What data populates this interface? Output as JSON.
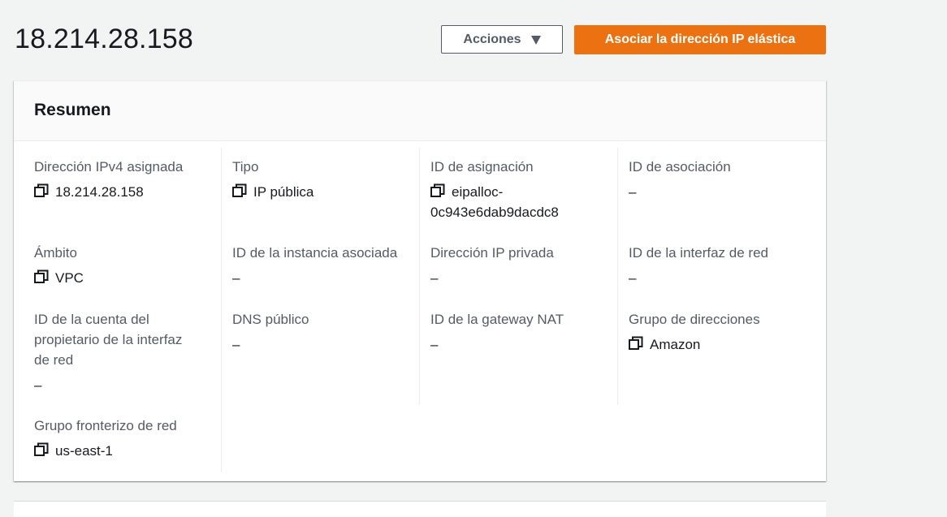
{
  "header": {
    "title": "18.214.28.158",
    "actions_label": "Acciones",
    "primary_label": "Asociar la dirección IP elástica"
  },
  "colors": {
    "primary": "#ec7211",
    "text": "#16191f",
    "label": "#545b64",
    "background": "#f2f3f3"
  },
  "summary": {
    "title": "Resumen",
    "fields": [
      {
        "label": "Dirección IPv4 asignada",
        "value": "18.214.28.158",
        "copyable": true
      },
      {
        "label": "Tipo",
        "value": "IP pública",
        "copyable": true
      },
      {
        "label": "ID de asignación",
        "value": "eipalloc-",
        "value2": "0c943e6dab9dacdc8",
        "copyable": true
      },
      {
        "label": "ID de asociación",
        "value": "–",
        "copyable": false
      },
      {
        "label": "Ámbito",
        "value": "VPC",
        "copyable": true
      },
      {
        "label": "ID de la instancia asociada",
        "value": "–",
        "copyable": false
      },
      {
        "label": "Dirección IP privada",
        "value": "–",
        "copyable": false
      },
      {
        "label": "ID de la interfaz de red",
        "value": "–",
        "copyable": false
      },
      {
        "label_lines": [
          "ID de la cuenta del",
          "propietario de la interfaz",
          "de red"
        ],
        "value": "–",
        "copyable": false
      },
      {
        "label": "DNS público",
        "value": "–",
        "copyable": false
      },
      {
        "label": "ID de la gateway NAT",
        "value": "–",
        "copyable": false
      },
      {
        "label": "Grupo de direcciones",
        "value": "Amazon",
        "copyable": true
      },
      {
        "label": "Grupo fronterizo de red",
        "value": "us-east-1",
        "copyable": true
      }
    ]
  }
}
